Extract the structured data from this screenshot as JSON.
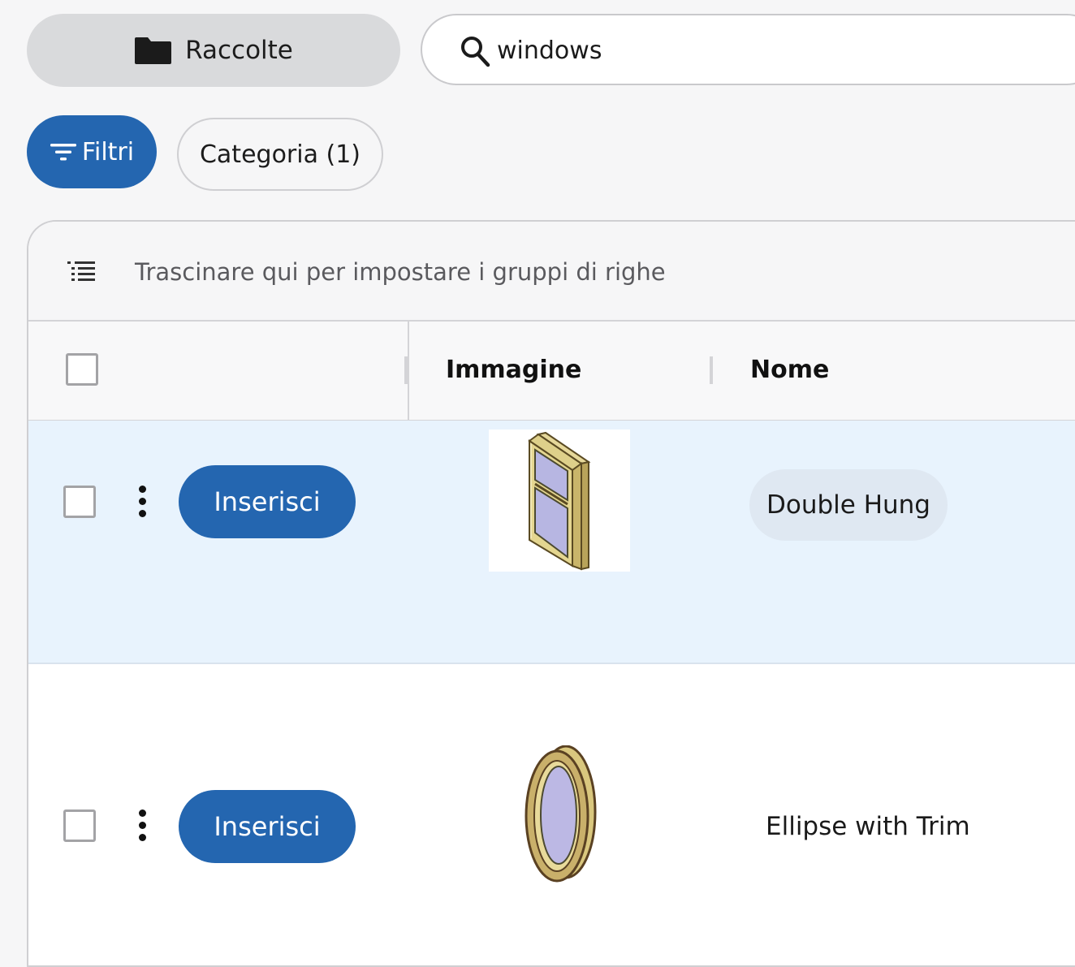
{
  "toolbar": {
    "collections_label": "Raccolte",
    "search": {
      "value": "windows",
      "placeholder": ""
    },
    "filters_label": "Filtri",
    "category_chip_label": "Categoria (1)"
  },
  "grid": {
    "group_panel_hint": "Trascinare qui per impostare i gruppi di righe",
    "columns": [
      {
        "key": "image",
        "title": "Immagine"
      },
      {
        "key": "name",
        "title": "Nome"
      }
    ],
    "rows": [
      {
        "action_label": "Inserisci",
        "image_icon": "double-hung-window",
        "name": "Double Hung",
        "selected": true
      },
      {
        "action_label": "Inserisci",
        "image_icon": "ellipse-window",
        "name": "Ellipse with Trim",
        "selected": false
      }
    ]
  },
  "colors": {
    "primary": "#2466b0",
    "selected_row": "#e8f3fd",
    "chip_bg": "#dfe8f2",
    "page_bg": "#f6f6f7"
  }
}
